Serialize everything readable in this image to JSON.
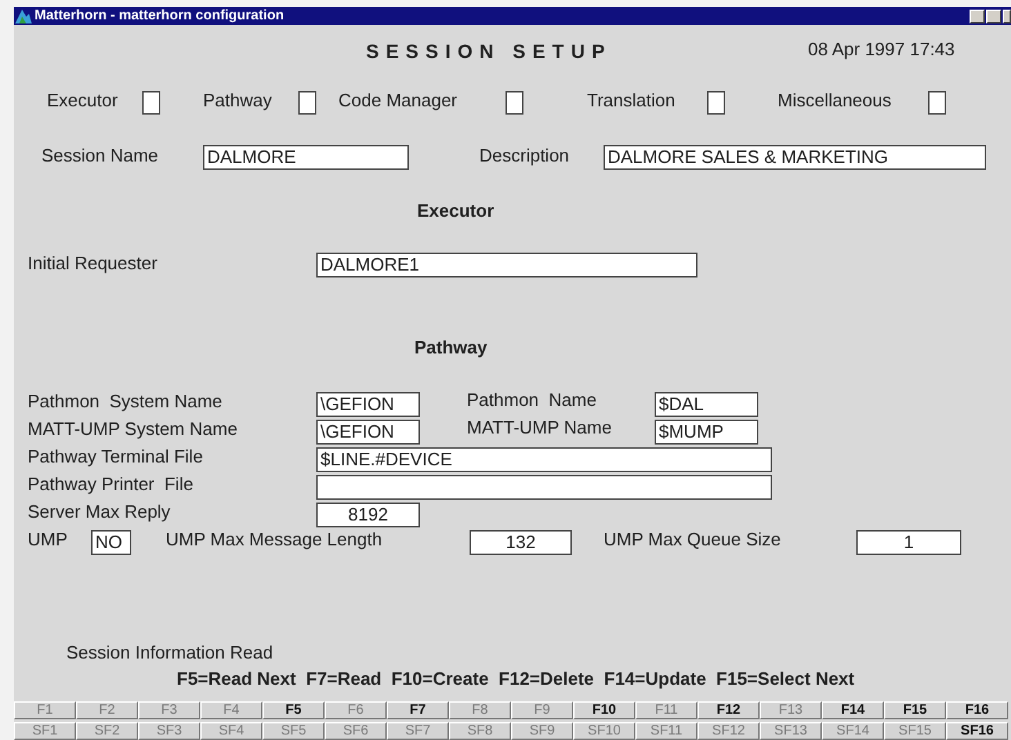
{
  "window": {
    "title": "Matterhorn - matterhorn configuration"
  },
  "header": {
    "title": "SESSION SETUP",
    "datetime": "08 Apr 1997 17:43"
  },
  "modules": [
    {
      "label": "Executor",
      "checked": false
    },
    {
      "label": "Pathway",
      "checked": false
    },
    {
      "label": "Code Manager",
      "checked": false
    },
    {
      "label": "Translation",
      "checked": false
    },
    {
      "label": "Miscellaneous",
      "checked": false
    }
  ],
  "session_name": {
    "label": "Session Name",
    "value": "DALMORE"
  },
  "description": {
    "label": "Description",
    "value": "DALMORE SALES & MARKETING"
  },
  "executor": {
    "heading": "Executor",
    "initial_requester": {
      "label": "Initial Requester",
      "value": "DALMORE1"
    }
  },
  "pathway": {
    "heading": "Pathway",
    "pathmon_system_name": {
      "label": "Pathmon  System Name",
      "value": "\\GEFION"
    },
    "pathmon_name": {
      "label": "Pathmon  Name",
      "value": "$DAL"
    },
    "matt_ump_system_name": {
      "label": "MATT-UMP System Name",
      "value": "\\GEFION"
    },
    "matt_ump_name": {
      "label": "MATT-UMP Name",
      "value": "$MUMP"
    },
    "terminal_file": {
      "label": "Pathway Terminal File",
      "value": "$LINE.#DEVICE"
    },
    "printer_file": {
      "label": "Pathway Printer  File"
    },
    "server_max_reply": {
      "label": "Server Max Reply",
      "value": "8192"
    },
    "ump": {
      "label": "UMP",
      "value": "NO"
    },
    "ump_max_message_length": {
      "label": "UMP Max Message Length",
      "value": "132"
    },
    "ump_max_queue_size": {
      "label": "UMP Max Queue Size",
      "value": "1"
    }
  },
  "status": {
    "message": "Session Information Read",
    "keys_help": "F5=Read Next  F7=Read  F10=Create  F12=Delete  F14=Update  F15=Select Next"
  },
  "function_keys": [
    {
      "label": "F1",
      "enabled": false
    },
    {
      "label": "F2",
      "enabled": false
    },
    {
      "label": "F3",
      "enabled": false
    },
    {
      "label": "F4",
      "enabled": false
    },
    {
      "label": "F5",
      "enabled": true
    },
    {
      "label": "F6",
      "enabled": false
    },
    {
      "label": "F7",
      "enabled": true
    },
    {
      "label": "F8",
      "enabled": false
    },
    {
      "label": "F9",
      "enabled": false
    },
    {
      "label": "F10",
      "enabled": true
    },
    {
      "label": "F11",
      "enabled": false
    },
    {
      "label": "F12",
      "enabled": true
    },
    {
      "label": "F13",
      "enabled": false
    },
    {
      "label": "F14",
      "enabled": true
    },
    {
      "label": "F15",
      "enabled": true
    },
    {
      "label": "F16",
      "enabled": true
    }
  ],
  "shift_function_keys": [
    {
      "label": "SF1",
      "enabled": false
    },
    {
      "label": "SF2",
      "enabled": false
    },
    {
      "label": "SF3",
      "enabled": false
    },
    {
      "label": "SF4",
      "enabled": false
    },
    {
      "label": "SF5",
      "enabled": false
    },
    {
      "label": "SF6",
      "enabled": false
    },
    {
      "label": "SF7",
      "enabled": false
    },
    {
      "label": "SF8",
      "enabled": false
    },
    {
      "label": "SF9",
      "enabled": false
    },
    {
      "label": "SF10",
      "enabled": false
    },
    {
      "label": "SF11",
      "enabled": false
    },
    {
      "label": "SF12",
      "enabled": false
    },
    {
      "label": "SF13",
      "enabled": false
    },
    {
      "label": "SF14",
      "enabled": false
    },
    {
      "label": "SF15",
      "enabled": false
    },
    {
      "label": "SF16",
      "enabled": true
    }
  ]
}
